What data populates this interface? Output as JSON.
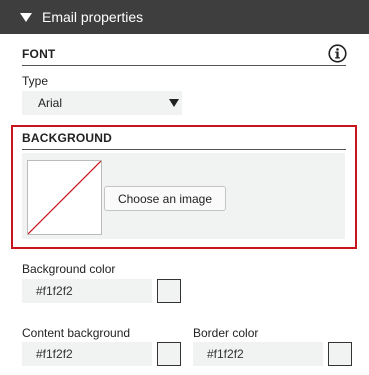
{
  "header": {
    "title": "Email properties"
  },
  "font": {
    "section_title": "FONT",
    "type_label": "Type",
    "type_value": "Arial"
  },
  "background": {
    "section_title": "BACKGROUND",
    "choose_image_label": "Choose an image",
    "highlight_color": "#c8141d"
  },
  "background_color": {
    "label": "Background color",
    "value": "#f1f2f2"
  },
  "content_background": {
    "label": "Content background",
    "value": "#f1f2f2"
  },
  "border_color": {
    "label": "Border color",
    "value": "#f1f2f2"
  },
  "icons": {
    "info": "info-icon",
    "collapse": "collapse-triangle-icon"
  }
}
